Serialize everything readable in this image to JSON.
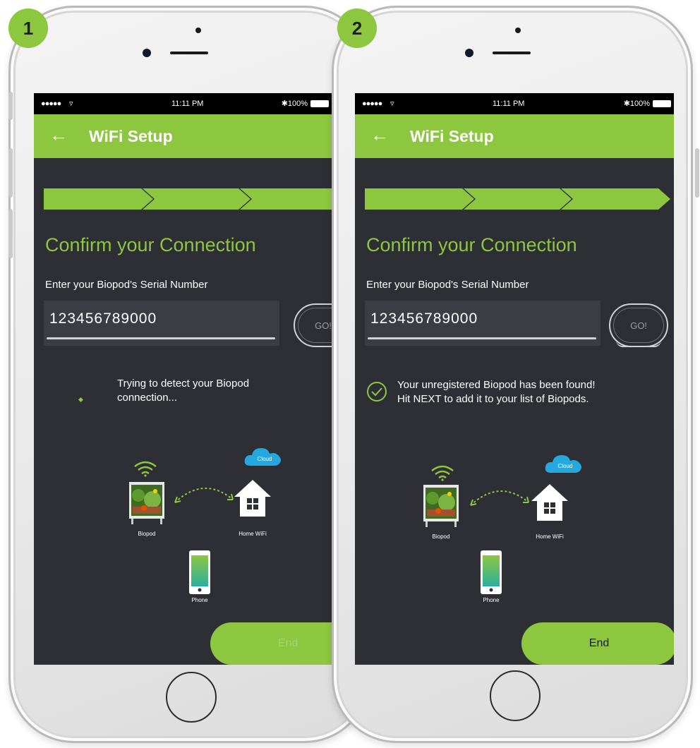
{
  "colors": {
    "accent_green": "#8dc63f",
    "screen_bg": "#2d2f35",
    "cloud_blue": "#25a8e0"
  },
  "steps": [
    {
      "badge": "1",
      "status_bar": {
        "signal": "●●●●●",
        "time": "11:11 PM",
        "battery": "100%"
      },
      "app_bar": {
        "back_icon": "arrow-left-icon",
        "title": "WiFi Setup"
      },
      "heading": "Confirm your Connection",
      "serial_label": "Enter your Biopod's Serial Number",
      "serial_value": "123456789000",
      "go_label": "GO!",
      "status_message": [
        "Trying to detect your Biopod",
        "connection..."
      ],
      "diagram": {
        "cloud": "Cloud",
        "biopod": "Biopod",
        "home_wifi": "Home WiFi",
        "phone": "Phone"
      },
      "end_label": "End"
    },
    {
      "badge": "2",
      "status_bar": {
        "signal": "●●●●●",
        "time": "11:11 PM",
        "battery": "100%"
      },
      "app_bar": {
        "back_icon": "arrow-left-icon",
        "title": "WiFi Setup"
      },
      "heading": "Confirm your Connection",
      "serial_label": "Enter your Biopod's Serial Number",
      "serial_value": "123456789000",
      "go_label": "GO!",
      "status_message": [
        "Your unregistered Biopod has been found!",
        "Hit NEXT to add it to your list of Biopods."
      ],
      "diagram": {
        "cloud": "Cloud",
        "biopod": "Biopod",
        "home_wifi": "Home WiFi",
        "phone": "Phone"
      },
      "end_label": "End"
    }
  ]
}
